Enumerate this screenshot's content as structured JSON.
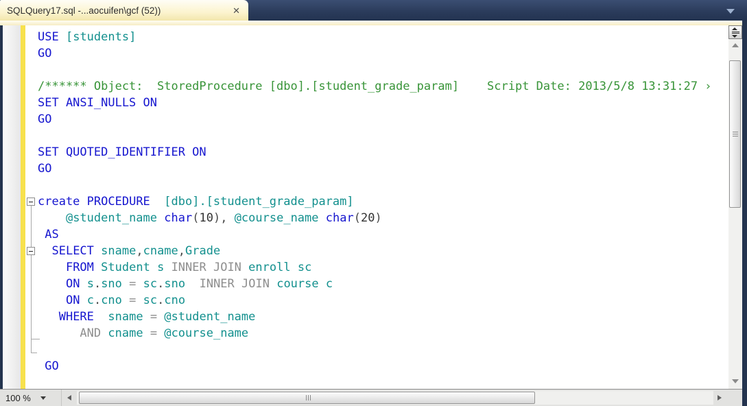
{
  "tab": {
    "title": "SQLQuery17.sql -...aocuifen\\gcf (52))",
    "close_glyph": "✕"
  },
  "statusbar": {
    "zoom_value": "100 %"
  },
  "colors": {
    "keyword_blue": "#1616cf",
    "identifier_teal": "#13908e",
    "comment_green": "#389438",
    "operator_gray": "#8e8e8e",
    "change_bar_yellow": "#f7e14d",
    "tab_strip_navy": "#2b3c5c",
    "active_tab_cream": "#fcf4cf"
  },
  "editor": {
    "lines": [
      [
        [
          "USE",
          "kw"
        ],
        [
          " ",
          "pl"
        ],
        [
          "[students]",
          "id"
        ]
      ],
      [
        [
          "GO",
          "kw"
        ]
      ],
      [],
      [
        [
          "/****** Object:  StoredProcedure [dbo].[student_grade_param]    Script Date: 2013/5/8 13:31:27 ›",
          "cm"
        ]
      ],
      [
        [
          "SET ANSI_NULLS ON",
          "kw"
        ]
      ],
      [
        [
          "GO",
          "kw"
        ]
      ],
      [],
      [
        [
          "SET QUOTED_IDENTIFIER ON",
          "kw"
        ]
      ],
      [
        [
          "GO",
          "kw"
        ]
      ],
      [],
      [
        [
          "create",
          "kw"
        ],
        [
          " ",
          "pl"
        ],
        [
          "PROCEDURE",
          "kw"
        ],
        [
          "  ",
          "pl"
        ],
        [
          "[dbo].[student_grade_param]",
          "id"
        ]
      ],
      [
        [
          "    ",
          "pl"
        ],
        [
          "@student_name",
          "id"
        ],
        [
          " ",
          "pl"
        ],
        [
          "char",
          "kw"
        ],
        [
          "(",
          "pn"
        ],
        [
          "10",
          "pl"
        ],
        [
          "),",
          "pn"
        ],
        [
          " ",
          "pl"
        ],
        [
          "@course_name",
          "id"
        ],
        [
          " ",
          "pl"
        ],
        [
          "char",
          "kw"
        ],
        [
          "(",
          "pn"
        ],
        [
          "20",
          "pl"
        ],
        [
          ")",
          "pn"
        ]
      ],
      [
        [
          " ",
          "pl"
        ],
        [
          "AS",
          "kw"
        ]
      ],
      [
        [
          "  ",
          "pl"
        ],
        [
          "SELECT",
          "kw"
        ],
        [
          " ",
          "pl"
        ],
        [
          "sname",
          "id"
        ],
        [
          ",",
          "pn"
        ],
        [
          "cname",
          "id"
        ],
        [
          ",",
          "pn"
        ],
        [
          "Grade",
          "id"
        ]
      ],
      [
        [
          "    ",
          "pl"
        ],
        [
          "FROM",
          "kw"
        ],
        [
          " ",
          "pl"
        ],
        [
          "Student",
          "id"
        ],
        [
          " ",
          "pl"
        ],
        [
          "s",
          "id"
        ],
        [
          " ",
          "pl"
        ],
        [
          "INNER JOIN",
          "gr"
        ],
        [
          " ",
          "pl"
        ],
        [
          "enroll",
          "id"
        ],
        [
          " ",
          "pl"
        ],
        [
          "sc",
          "id"
        ]
      ],
      [
        [
          "    ",
          "pl"
        ],
        [
          "ON",
          "kw"
        ],
        [
          " ",
          "pl"
        ],
        [
          "s",
          "id"
        ],
        [
          ".",
          "pn"
        ],
        [
          "sno",
          "id"
        ],
        [
          " ",
          "pl"
        ],
        [
          "=",
          "gr"
        ],
        [
          " ",
          "pl"
        ],
        [
          "sc",
          "id"
        ],
        [
          ".",
          "pn"
        ],
        [
          "sno",
          "id"
        ],
        [
          "  ",
          "pl"
        ],
        [
          "INNER JOIN",
          "gr"
        ],
        [
          " ",
          "pl"
        ],
        [
          "course",
          "id"
        ],
        [
          " ",
          "pl"
        ],
        [
          "c",
          "id"
        ]
      ],
      [
        [
          "    ",
          "pl"
        ],
        [
          "ON",
          "kw"
        ],
        [
          " ",
          "pl"
        ],
        [
          "c",
          "id"
        ],
        [
          ".",
          "pn"
        ],
        [
          "cno",
          "id"
        ],
        [
          " ",
          "pl"
        ],
        [
          "=",
          "gr"
        ],
        [
          " ",
          "pl"
        ],
        [
          "sc",
          "id"
        ],
        [
          ".",
          "pn"
        ],
        [
          "cno",
          "id"
        ]
      ],
      [
        [
          "   ",
          "pl"
        ],
        [
          "WHERE",
          "kw"
        ],
        [
          "  ",
          "pl"
        ],
        [
          "sname",
          "id"
        ],
        [
          " ",
          "pl"
        ],
        [
          "=",
          "gr"
        ],
        [
          " ",
          "pl"
        ],
        [
          "@student_name",
          "id"
        ]
      ],
      [
        [
          "      ",
          "pl"
        ],
        [
          "AND",
          "gr"
        ],
        [
          " ",
          "pl"
        ],
        [
          "cname",
          "id"
        ],
        [
          " ",
          "pl"
        ],
        [
          "=",
          "gr"
        ],
        [
          " ",
          "pl"
        ],
        [
          "@course_name",
          "id"
        ]
      ],
      [],
      [
        [
          " ",
          "pl"
        ],
        [
          "GO",
          "kw"
        ]
      ]
    ]
  }
}
